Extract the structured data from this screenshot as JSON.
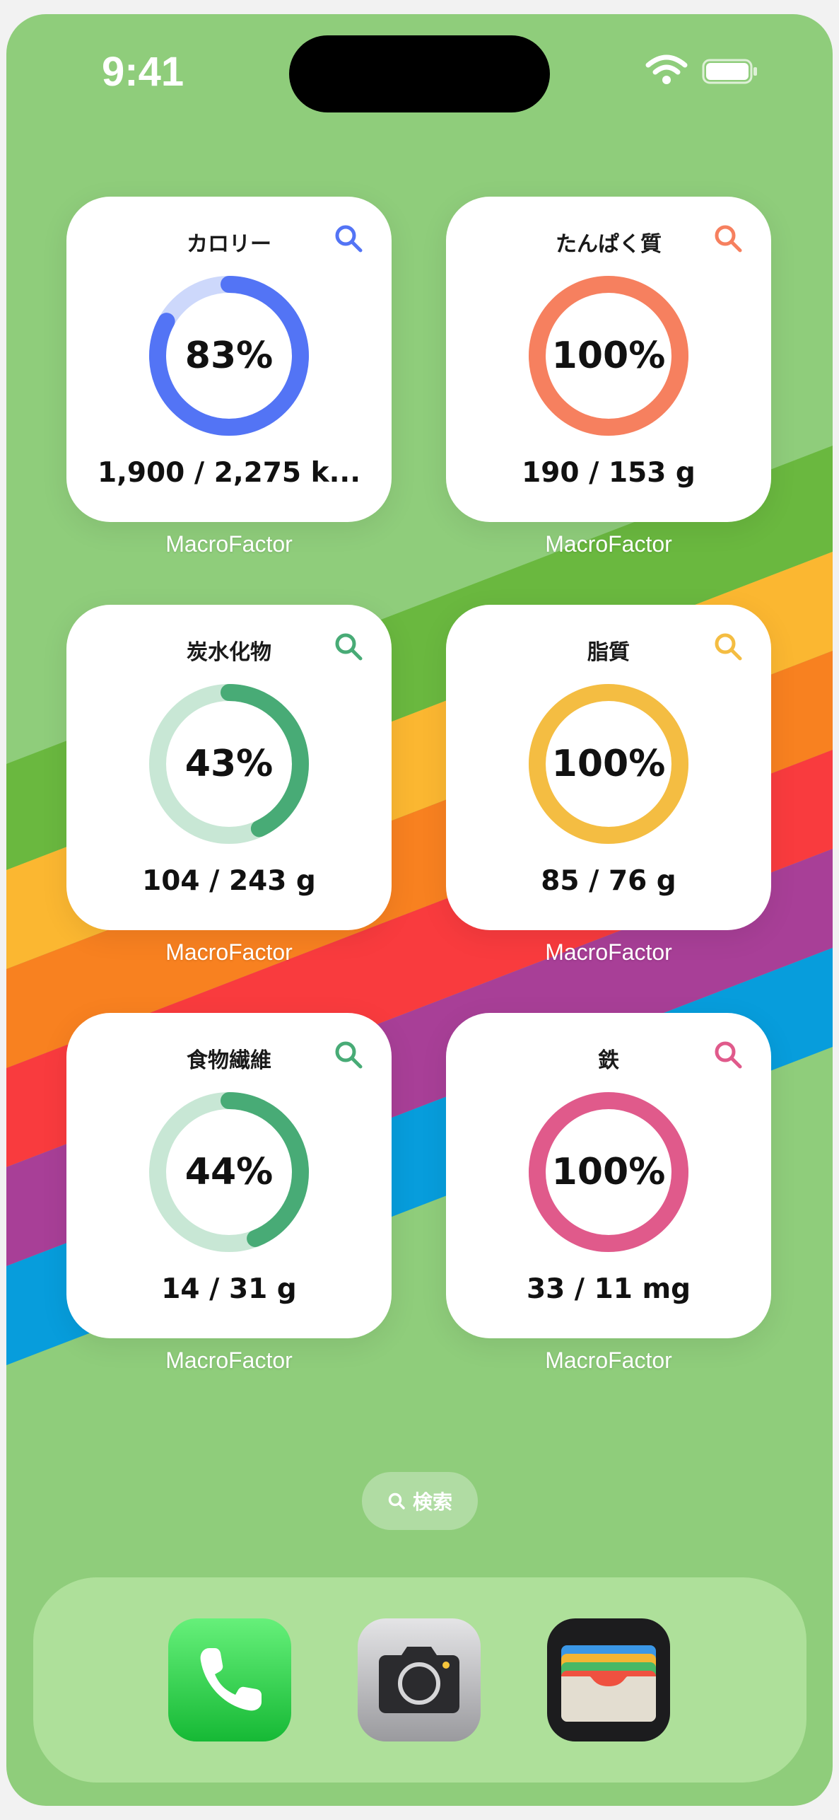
{
  "status_bar": {
    "time": "9:41"
  },
  "widgets": [
    {
      "title": "カロリー",
      "percent_label": "83%",
      "value": "1,900 / 2,275 k...",
      "progress": 0.83,
      "color": "#5374f5",
      "track": "#cdd8fb",
      "app": "MacroFactor"
    },
    {
      "title": "たんぱく質",
      "percent_label": "100%",
      "value": "190 / 153 g",
      "progress": 1.0,
      "color": "#f6805f",
      "track": "#fcd9cf",
      "app": "MacroFactor"
    },
    {
      "title": "炭水化物",
      "percent_label": "43%",
      "value": "104 / 243 g",
      "progress": 0.43,
      "color": "#48ab76",
      "track": "#c8e7d5",
      "app": "MacroFactor"
    },
    {
      "title": "脂質",
      "percent_label": "100%",
      "value": "85 / 76 g",
      "progress": 1.0,
      "color": "#f4bd42",
      "track": "#fbebc3",
      "app": "MacroFactor"
    },
    {
      "title": "食物繊維",
      "percent_label": "44%",
      "value": "14 / 31 g",
      "progress": 0.44,
      "color": "#48ab76",
      "track": "#c8e7d5",
      "app": "MacroFactor"
    },
    {
      "title": "鉄",
      "percent_label": "100%",
      "value": "33 / 11 mg",
      "progress": 1.0,
      "color": "#e05a8b",
      "track": "#f7cfdd",
      "app": "MacroFactor"
    }
  ],
  "search": {
    "label": "検索"
  },
  "dock": {
    "apps": [
      "phone-icon",
      "camera-icon",
      "wallet-icon"
    ]
  }
}
